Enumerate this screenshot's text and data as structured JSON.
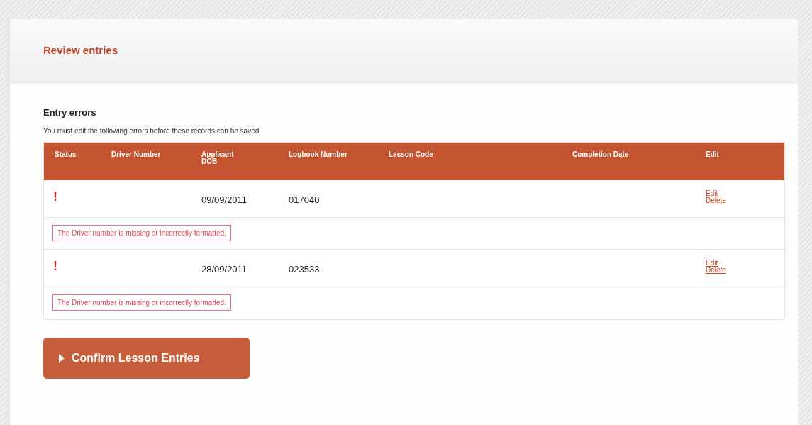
{
  "header": {
    "title": "Review entries"
  },
  "section": {
    "title": "Entry errors",
    "message": "You must edit the following errors before these records can be saved."
  },
  "table": {
    "columns": [
      "Status",
      "Driver Number",
      "Applicant DOB",
      "Logbook Number",
      "Lesson Code",
      "Completion Date",
      "Edit"
    ],
    "rows": [
      {
        "status": "!",
        "driver_number": "",
        "dob": "09/09/2011",
        "logbook": "017040",
        "lesson_code": "",
        "completion_date": "",
        "actions": [
          "Edit",
          "Delete"
        ],
        "error": "The Driver number is missing or incorrectly formatted."
      },
      {
        "status": "!",
        "driver_number": "",
        "dob": "28/09/2011",
        "logbook": "023533",
        "lesson_code": "",
        "completion_date": "",
        "actions": [
          "Edit",
          "Delete"
        ],
        "error": "The Driver number is missing or incorrectly formatted."
      }
    ]
  },
  "confirm_button": {
    "label": "Confirm Lesson Entries"
  }
}
